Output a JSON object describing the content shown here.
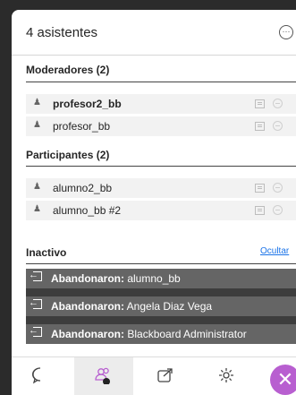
{
  "header": {
    "title": "4 asistentes",
    "more_icon": "ellipsis-circle-icon"
  },
  "sections": {
    "moderators": {
      "title": "Moderadores (2)"
    },
    "participants": {
      "title": "Participantes (2)"
    },
    "inactive": {
      "title": "Inactivo",
      "hide_label": "Ocultar"
    }
  },
  "moderators": [
    {
      "name": "profesor2_bb"
    },
    {
      "name": "profesor_bb"
    }
  ],
  "participants": [
    {
      "name": "alumno2_bb"
    },
    {
      "name": "alumno_bb #2"
    }
  ],
  "left_users": [
    {
      "prefix": "Abandonaron:",
      "name": "alumno_bb"
    },
    {
      "prefix": "Abandonaron:",
      "name": "Angela Diaz Vega"
    },
    {
      "prefix": "Abandonaron:",
      "name": "Blackboard Administrator"
    }
  ],
  "bottom_tabs": [
    "chat-icon",
    "attendees-icon",
    "share-content-icon",
    "settings-icon"
  ],
  "colors": {
    "accent": "#b85fd0",
    "link": "#1a73e8",
    "left_row_bg": "#656565"
  }
}
